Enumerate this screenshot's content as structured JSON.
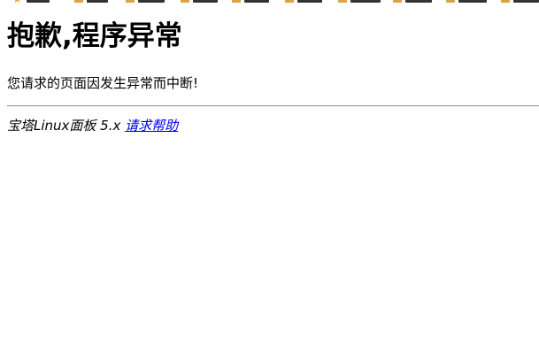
{
  "page": {
    "heading": "抱歉,程序异常",
    "message": "您请求的页面因发生异常而中断!",
    "footer_text": "宝塔Linux面板 5.x",
    "help_link": "请求帮助"
  },
  "colors": {
    "link": "#0000ee",
    "text": "#000000",
    "divider": "#9a9a9a",
    "bookmark_folder": "#d9a441",
    "bookmark_star": "#e0a526"
  },
  "icons": {
    "bookmark_star": "star-icon",
    "bookmark_folder": "folder-icon"
  }
}
